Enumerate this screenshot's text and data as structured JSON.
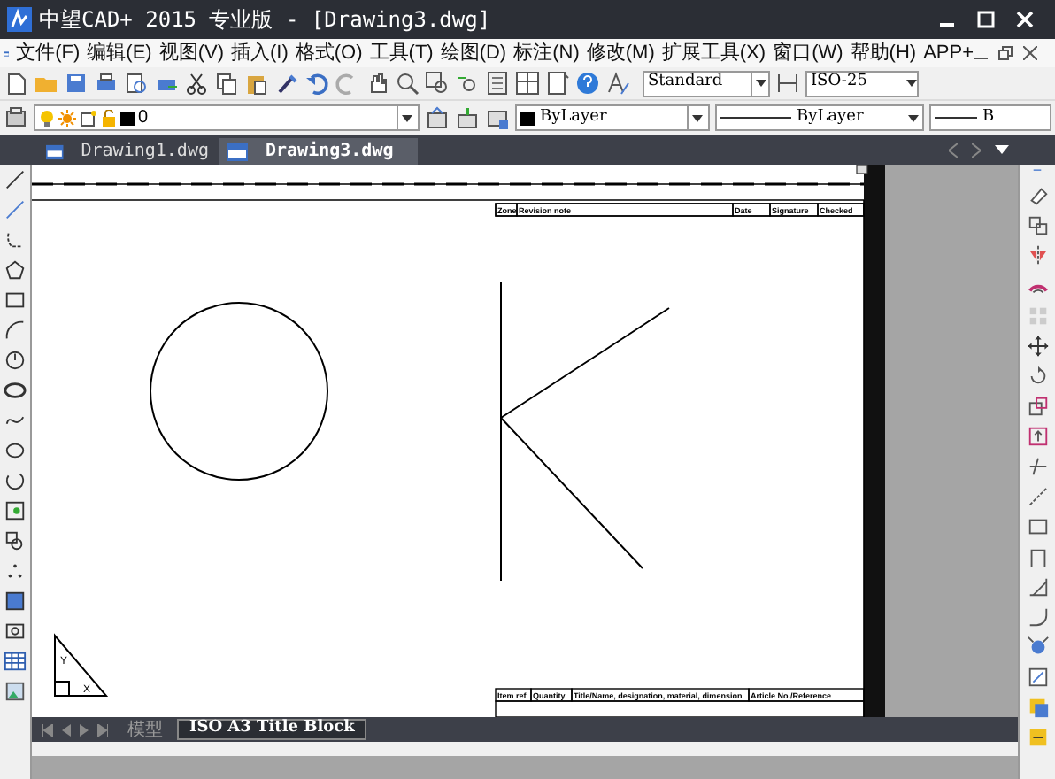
{
  "window": {
    "title": "中望CAD+ 2015 专业版 - [Drawing3.dwg]"
  },
  "menu": [
    "文件(F)",
    "编辑(E)",
    "视图(V)",
    "插入(I)",
    "格式(O)",
    "工具(T)",
    "绘图(D)",
    "标注(N)",
    "修改(M)",
    "扩展工具(X)",
    "窗口(W)",
    "帮助(H)",
    "APP+"
  ],
  "styles": {
    "text_style": "Standard",
    "dim_style": "ISO-25"
  },
  "properties": {
    "layer": "0",
    "color_setting": "ByLayer",
    "linetype": "ByLayer",
    "lineweight": "B"
  },
  "document_tabs": [
    {
      "label": "Drawing1.dwg",
      "selected": false
    },
    {
      "label": "Drawing3.dwg",
      "selected": true
    }
  ],
  "title_block": {
    "revision_header": [
      "Zone",
      "Revision note",
      "Date",
      "Signature",
      "Checked"
    ],
    "parts_header": [
      "Item ref",
      "Quantity",
      "Title/Name, designation, material, dimension",
      "Article No./Reference"
    ]
  },
  "ucs_icon": {
    "y_label": "Y",
    "x_label": "X"
  },
  "layout_tabs": [
    {
      "label": "模型",
      "selected": false
    },
    {
      "label": "ISO A3 Title Block",
      "selected": true
    }
  ]
}
